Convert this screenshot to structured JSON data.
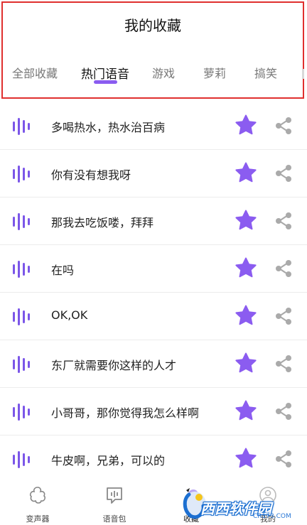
{
  "header": {
    "title": "我的收藏",
    "tabs": [
      {
        "label": "全部收藏",
        "active": false
      },
      {
        "label": "热门语音",
        "active": true
      },
      {
        "label": "游戏",
        "active": false
      },
      {
        "label": "萝莉",
        "active": false
      },
      {
        "label": "搞笑",
        "active": false
      }
    ]
  },
  "list": {
    "items": [
      {
        "label": "多喝热水，热水治百病",
        "favorited": true
      },
      {
        "label": "你有没有想我呀",
        "favorited": true
      },
      {
        "label": "那我去吃饭喽，拜拜",
        "favorited": true
      },
      {
        "label": "在吗",
        "favorited": true
      },
      {
        "label": "OK,OK",
        "favorited": true
      },
      {
        "label": "东厂就需要你这样的人才",
        "favorited": true
      },
      {
        "label": "小哥哥，那你觉得我怎么样啊",
        "favorited": true
      },
      {
        "label": "牛皮啊，兄弟，可以的",
        "favorited": true
      }
    ]
  },
  "bottom_nav": {
    "items": [
      {
        "label": "变声器",
        "icon": "voice-changer-icon"
      },
      {
        "label": "语音包",
        "icon": "voice-pack-icon"
      },
      {
        "label": "收藏",
        "icon": "favorites-icon",
        "active": true
      },
      {
        "label": "我的",
        "icon": "profile-icon"
      }
    ]
  },
  "watermark": {
    "text": "西西软件园",
    "sub": "CR173.COM"
  },
  "colors": {
    "accent": "#8a5cf0",
    "star": "#8b5cf0",
    "share": "#aaaaaa",
    "header_border": "#e0302f"
  }
}
